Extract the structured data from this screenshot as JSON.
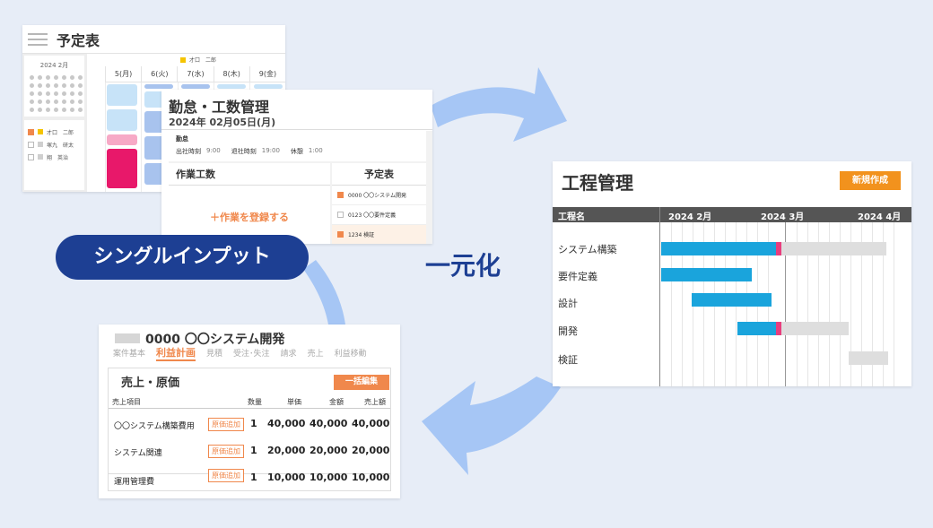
{
  "colors": {
    "navy": "#1d3f93",
    "orange": "#f0884c",
    "cyan": "#1aa4dc",
    "pink": "#e83e7e",
    "arrow": "#a6c6f5",
    "gray_bar": "#dedede"
  },
  "calendar": {
    "title": "予定表",
    "month": "2024 2月",
    "legend": "才口　二郎",
    "days": [
      "5(月)",
      "6(火)",
      "7(水)",
      "8(木)",
      "9(金)"
    ],
    "people": [
      {
        "name": "才口　二郎",
        "checked": true,
        "color": "#f5c400"
      },
      {
        "name": "塚九　研太",
        "checked": false,
        "color": "#cfcfcf"
      },
      {
        "name": "翔　英治",
        "checked": false,
        "color": "#cfcfcf"
      }
    ]
  },
  "attendance": {
    "title": "勤怠・工数管理",
    "date": "2024年 02月05日(月)",
    "kintai_label": "勤怠",
    "in_label": "出社時刻",
    "in_value": "9:00",
    "out_label": "退社時刻",
    "out_value": "19:00",
    "break_label": "休憩",
    "break_value": "1:00",
    "work_header": "作業工数",
    "register": "＋作業を登録する",
    "schedule_header": "予定表",
    "schedule_items": [
      {
        "label": "0000 〇〇システム開発",
        "checked": true,
        "highlight": false
      },
      {
        "label": "0123 〇〇要件定義",
        "checked": false,
        "highlight": false
      },
      {
        "label": "1234 検証",
        "checked": true,
        "highlight": true
      }
    ]
  },
  "single_input": "シングルインプット",
  "unification": "一元化",
  "gantt": {
    "title": "工程管理",
    "new_button": "新規作成",
    "name_header": "工程名",
    "months": [
      "2024 2月",
      "2024 3月",
      "2024 4月"
    ],
    "tasks": [
      "システム構築",
      "要件定義",
      "設計",
      "開発",
      "検証"
    ]
  },
  "sales": {
    "project": "0000 〇〇システム開発",
    "tabs": [
      "案件基本",
      "利益計画",
      "見積",
      "受注･失注",
      "請求",
      "売上",
      "利益移動"
    ],
    "active_tab": "利益計画",
    "section": "売上・原価",
    "bulk_edit": "一括編集",
    "columns": [
      "売上項目",
      "数量",
      "単価",
      "金額",
      "売上額"
    ],
    "rows": [
      {
        "name": "〇〇システム構築費用",
        "tag": "原価追加",
        "qty": "1",
        "price": "40,000",
        "amount": "40,000",
        "sales": "40,000"
      },
      {
        "name": "システム関連",
        "tag": "原価追加",
        "qty": "1",
        "price": "20,000",
        "amount": "20,000",
        "sales": "20,000"
      },
      {
        "name": "運用管理費",
        "tag": "原価追加",
        "qty": "1",
        "price": "10,000",
        "amount": "10,000",
        "sales": "10,000"
      }
    ]
  }
}
